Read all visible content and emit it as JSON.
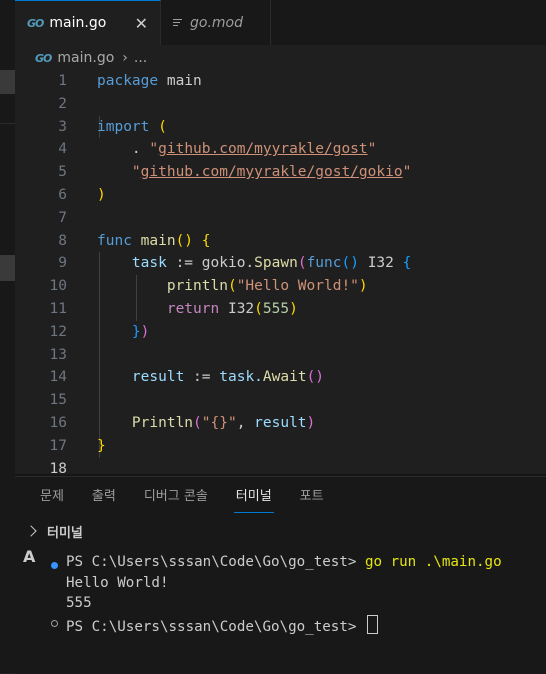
{
  "tabs": [
    {
      "icon": "go-file-icon",
      "icon_text": "GO",
      "label": "main.go",
      "active": true,
      "close": "✕"
    },
    {
      "icon": "lines-file-icon",
      "label": "go.mod",
      "active": false
    }
  ],
  "breadcrumb": {
    "icon_text": "GO",
    "file": "main.go",
    "rest": "..."
  },
  "editor": {
    "line_numbers": [
      "1",
      "2",
      "3",
      "4",
      "5",
      "6",
      "7",
      "8",
      "9",
      "10",
      "11",
      "12",
      "13",
      "14",
      "15",
      "16",
      "17",
      "18"
    ],
    "current_line": "18",
    "code": {
      "l1_kw": "package",
      "l1_name": "main",
      "l3_kw": "import",
      "l3_paren": "(",
      "l4_dot": ".",
      "l4_q1": "\"",
      "l4_path": "github.com/myyrakle/gost",
      "l4_q2": "\"",
      "l5_q1": "\"",
      "l5_path": "github.com/myyrakle/gost/gokio",
      "l5_q2": "\"",
      "l6_paren": ")",
      "l8_kw": "func",
      "l8_name": "main",
      "l8_parens": "()",
      "l8_brace": "{",
      "l9_var": "task",
      "l9_op": ":=",
      "l9_pkg": "gokio.",
      "l9_fn": "Spawn",
      "l9_p1": "(",
      "l9_kw": "func",
      "l9_p2": "()",
      "l9_type": "I32",
      "l9_brace": "{",
      "l10_fn": "println",
      "l10_p1": "(",
      "l10_str": "\"Hello World!\"",
      "l10_p2": ")",
      "l11_kw": "return",
      "l11_type": "I32",
      "l11_p1": "(",
      "l11_num": "555",
      "l11_p2": ")",
      "l12_brace": "}",
      "l12_paren": ")",
      "l14_var": "result",
      "l14_op": ":=",
      "l14_obj": "task.",
      "l14_fn": "Await",
      "l14_parens": "()",
      "l16_fn": "Println",
      "l16_p1": "(",
      "l16_str": "\"{}\"",
      "l16_comma": ",",
      "l16_arg": "result",
      "l16_p2": ")",
      "l17_brace": "}"
    }
  },
  "panel": {
    "tabs": [
      "문제",
      "출력",
      "디버그 콘솔",
      "터미널",
      "포트"
    ],
    "active_tab": "터미널",
    "terminal_header": "터미널",
    "shell_icon": "A",
    "lines": [
      {
        "prompt": "PS C:\\Users\\sssan\\Code\\Go\\go_test> ",
        "cmd": "go run .\\main.go",
        "status": "success"
      },
      {
        "text": "Hello World!"
      },
      {
        "text": "555"
      },
      {
        "prompt": "PS C:\\Users\\sssan\\Code\\Go\\go_test> ",
        "status": "idle"
      }
    ]
  },
  "colors": {
    "accent": "#0078d4",
    "keyword": "#569cd6",
    "string": "#ce9178",
    "function": "#dcdcaa",
    "terminal_command": "#e5e510"
  }
}
